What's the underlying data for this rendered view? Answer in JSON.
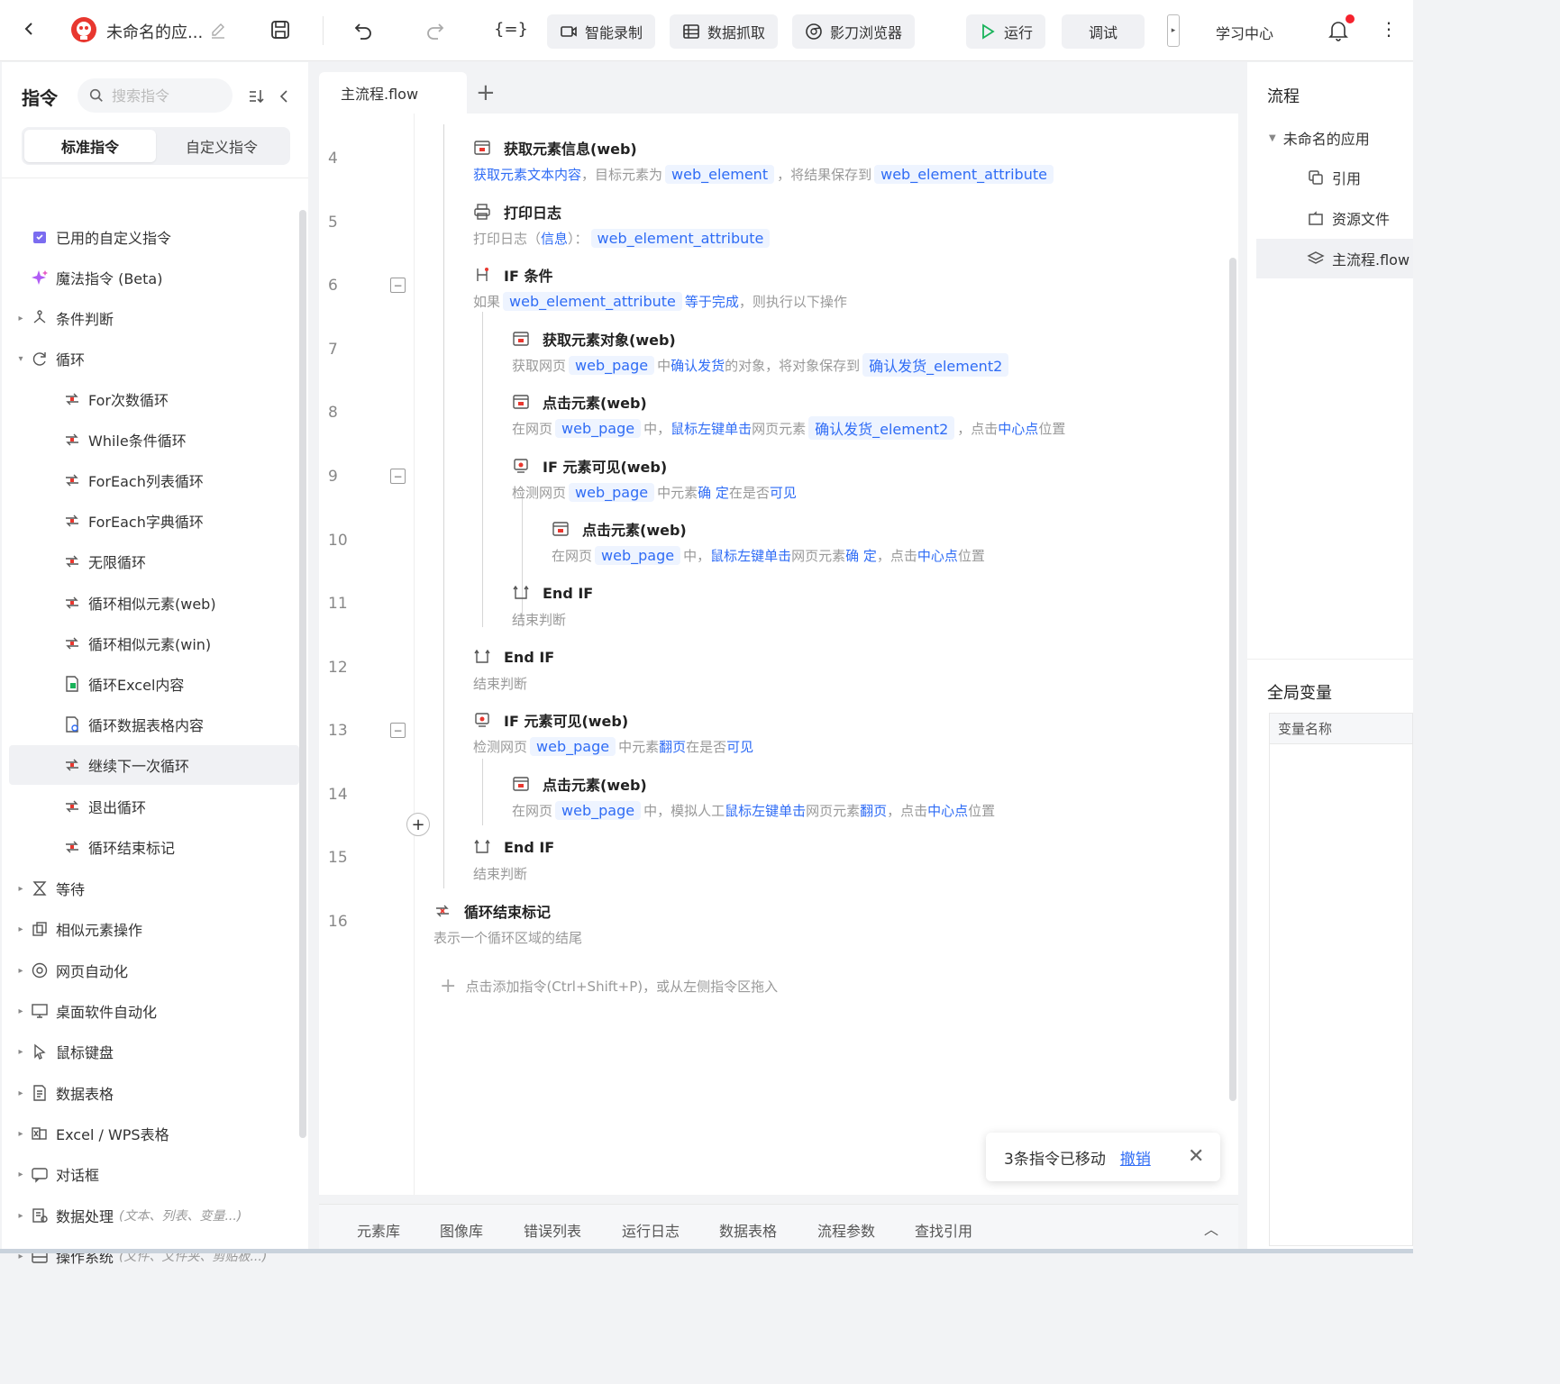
{
  "topbar": {
    "app_name": "未命名的应...",
    "buttons": {
      "record": "智能录制",
      "scrape": "数据抓取",
      "browser": "影刀浏览器",
      "run": "运行",
      "debug": "调试"
    },
    "learning_center": "学习中心",
    "accent_color": "#2f6cf5",
    "run_icon_color": "#19b35a",
    "notification_dot_color": "#f5222d"
  },
  "left_panel": {
    "title": "指令",
    "search_placeholder": "搜索指令",
    "segments": [
      "标准指令",
      "自定义指令"
    ],
    "items": [
      {
        "label": "已用的自定义指令",
        "icon": "custom-command-icon",
        "indent": 0,
        "caret": ""
      },
      {
        "label": "魔法指令 (Beta)",
        "icon": "magic-sparkle-icon",
        "indent": 0,
        "caret": ""
      },
      {
        "label": "条件判断",
        "icon": "branch-icon",
        "indent": 0,
        "caret": "▸"
      },
      {
        "label": "循环",
        "icon": "loop-refresh-icon",
        "indent": 0,
        "caret": "▾"
      },
      {
        "label": "For次数循环",
        "icon": "for-loop-icon",
        "indent": 1,
        "caret": ""
      },
      {
        "label": "While条件循环",
        "icon": "while-loop-icon",
        "indent": 1,
        "caret": ""
      },
      {
        "label": "ForEach列表循环",
        "icon": "foreach-list-icon",
        "indent": 1,
        "caret": ""
      },
      {
        "label": "ForEach字典循环",
        "icon": "foreach-dict-icon",
        "indent": 1,
        "caret": ""
      },
      {
        "label": "无限循环",
        "icon": "infinite-loop-icon",
        "indent": 1,
        "caret": ""
      },
      {
        "label": "循环相似元素(web)",
        "icon": "loop-web-icon",
        "indent": 1,
        "caret": ""
      },
      {
        "label": "循环相似元素(win)",
        "icon": "loop-win-icon",
        "indent": 1,
        "caret": ""
      },
      {
        "label": "循环Excel内容",
        "icon": "loop-excel-icon",
        "indent": 1,
        "caret": ""
      },
      {
        "label": "循环数据表格内容",
        "icon": "loop-table-icon",
        "indent": 1,
        "caret": ""
      },
      {
        "label": "继续下一次循环",
        "icon": "continue-loop-icon",
        "indent": 1,
        "caret": "",
        "selected": true
      },
      {
        "label": "退出循环",
        "icon": "break-loop-icon",
        "indent": 1,
        "caret": ""
      },
      {
        "label": "循环结束标记",
        "icon": "loop-end-icon",
        "indent": 1,
        "caret": ""
      },
      {
        "label": "等待",
        "icon": "hourglass-icon",
        "indent": 0,
        "caret": "▸"
      },
      {
        "label": "相似元素操作",
        "icon": "similar-elements-icon",
        "indent": 0,
        "caret": "▸"
      },
      {
        "label": "网页自动化",
        "icon": "web-automation-icon",
        "indent": 0,
        "caret": "▸"
      },
      {
        "label": "桌面软件自动化",
        "icon": "desktop-icon",
        "indent": 0,
        "caret": "▸"
      },
      {
        "label": "鼠标键盘",
        "icon": "mouse-pointer-icon",
        "indent": 0,
        "caret": "▸"
      },
      {
        "label": "数据表格",
        "icon": "data-table-icon",
        "indent": 0,
        "caret": "▸"
      },
      {
        "label": "Excel / WPS表格",
        "icon": "excel-icon",
        "indent": 0,
        "caret": "▸"
      },
      {
        "label": "对话框",
        "icon": "dialog-icon",
        "indent": 0,
        "caret": "▸"
      },
      {
        "label": "数据处理",
        "hint": "(文本、列表、变量...)",
        "icon": "data-process-icon",
        "indent": 0,
        "caret": "▸"
      },
      {
        "label": "操作系统",
        "hint": "(文件、文件夹、剪贴板...)",
        "icon": "os-icon",
        "indent": 0,
        "caret": "▸"
      }
    ]
  },
  "editor": {
    "tab": "主流程.flow",
    "line_numbers": [
      "4",
      "5",
      "6",
      "7",
      "8",
      "9",
      "10",
      "11",
      "12",
      "13",
      "14",
      "15",
      "16"
    ],
    "add_hint": "点击添加指令(Ctrl+Shift+P)，或从左侧指令区拖入",
    "commands": [
      {
        "title": "获取元素信息(web)",
        "desc": [
          {
            "t": "获取元素文本内容",
            "k": "kw"
          },
          {
            "t": "，目标元素为"
          },
          {
            "t": "web_element",
            "k": "var"
          },
          {
            "t": "，将结果保存到"
          },
          {
            "t": "web_element_attribute",
            "k": "var"
          }
        ]
      },
      {
        "title": "打印日志",
        "desc": [
          {
            "t": "打印日志（"
          },
          {
            "t": "信息",
            "k": "kw"
          },
          {
            "t": "）："
          },
          {
            "t": "web_element_attribute",
            "k": "var"
          }
        ]
      },
      {
        "title": "IF 条件",
        "desc": [
          {
            "t": "如果"
          },
          {
            "t": "web_element_attribute",
            "k": "var"
          },
          {
            "t": "等于完成",
            "k": "kw"
          },
          {
            "t": "，则执行以下操作"
          }
        ]
      },
      {
        "title": "获取元素对象(web)",
        "desc": [
          {
            "t": "获取网页"
          },
          {
            "t": "web_page",
            "k": "var"
          },
          {
            "t": "中"
          },
          {
            "t": "确认发货",
            "k": "kw"
          },
          {
            "t": "的对象，将对象保存到"
          },
          {
            "t": "确认发货_element2",
            "k": "var"
          }
        ]
      },
      {
        "title": "点击元素(web)",
        "desc": [
          {
            "t": "在网页"
          },
          {
            "t": "web_page",
            "k": "var"
          },
          {
            "t": "中，"
          },
          {
            "t": "鼠标左键单击",
            "k": "kw"
          },
          {
            "t": "网页元素"
          },
          {
            "t": "确认发货_element2",
            "k": "var"
          },
          {
            "t": "，点击"
          },
          {
            "t": "中心点",
            "k": "kw"
          },
          {
            "t": "位置"
          }
        ]
      },
      {
        "title": "IF 元素可见(web)",
        "desc": [
          {
            "t": "检测网页"
          },
          {
            "t": "web_page",
            "k": "var"
          },
          {
            "t": "中元素"
          },
          {
            "t": "确 定",
            "k": "kw"
          },
          {
            "t": "在是否"
          },
          {
            "t": "可见",
            "k": "kw"
          }
        ]
      },
      {
        "title": "点击元素(web)",
        "desc": [
          {
            "t": "在网页"
          },
          {
            "t": "web_page",
            "k": "var"
          },
          {
            "t": "中，"
          },
          {
            "t": "鼠标左键单击",
            "k": "kw"
          },
          {
            "t": "网页元素"
          },
          {
            "t": "确 定",
            "k": "kw"
          },
          {
            "t": "，点击"
          },
          {
            "t": "中心点",
            "k": "kw"
          },
          {
            "t": "位置"
          }
        ]
      },
      {
        "title": "End IF",
        "desc": [
          {
            "t": "结束判断"
          }
        ]
      },
      {
        "title": "End IF",
        "desc": [
          {
            "t": "结束判断"
          }
        ]
      },
      {
        "title": "IF 元素可见(web)",
        "desc": [
          {
            "t": "检测网页"
          },
          {
            "t": "web_page",
            "k": "var"
          },
          {
            "t": "中元素"
          },
          {
            "t": "翻页",
            "k": "kw"
          },
          {
            "t": "在是否"
          },
          {
            "t": "可见",
            "k": "kw"
          }
        ]
      },
      {
        "title": "点击元素(web)",
        "desc": [
          {
            "t": "在网页"
          },
          {
            "t": "web_page",
            "k": "var"
          },
          {
            "t": "中，模拟人工"
          },
          {
            "t": "鼠标左键单击",
            "k": "kw"
          },
          {
            "t": "网页元素"
          },
          {
            "t": "翻页",
            "k": "kw"
          },
          {
            "t": "，点击"
          },
          {
            "t": "中心点",
            "k": "kw"
          },
          {
            "t": "位置"
          }
        ]
      },
      {
        "title": "End IF",
        "desc": [
          {
            "t": "结束判断"
          }
        ]
      },
      {
        "title": "循环结束标记",
        "desc": [
          {
            "t": "表示一个循环区域的结尾"
          }
        ]
      }
    ]
  },
  "toast": {
    "message": "3条指令已移动",
    "undo": "撤销"
  },
  "bottom_tabs": [
    "元素库",
    "图像库",
    "错误列表",
    "运行日志",
    "数据表格",
    "流程参数",
    "查找引用"
  ],
  "right_panel": {
    "flow_title": "流程",
    "app_name": "未命名的应用",
    "items": [
      "引用",
      "资源文件",
      "主流程.flow"
    ],
    "globals_title": "全局变量",
    "var_col_header": "变量名称"
  }
}
